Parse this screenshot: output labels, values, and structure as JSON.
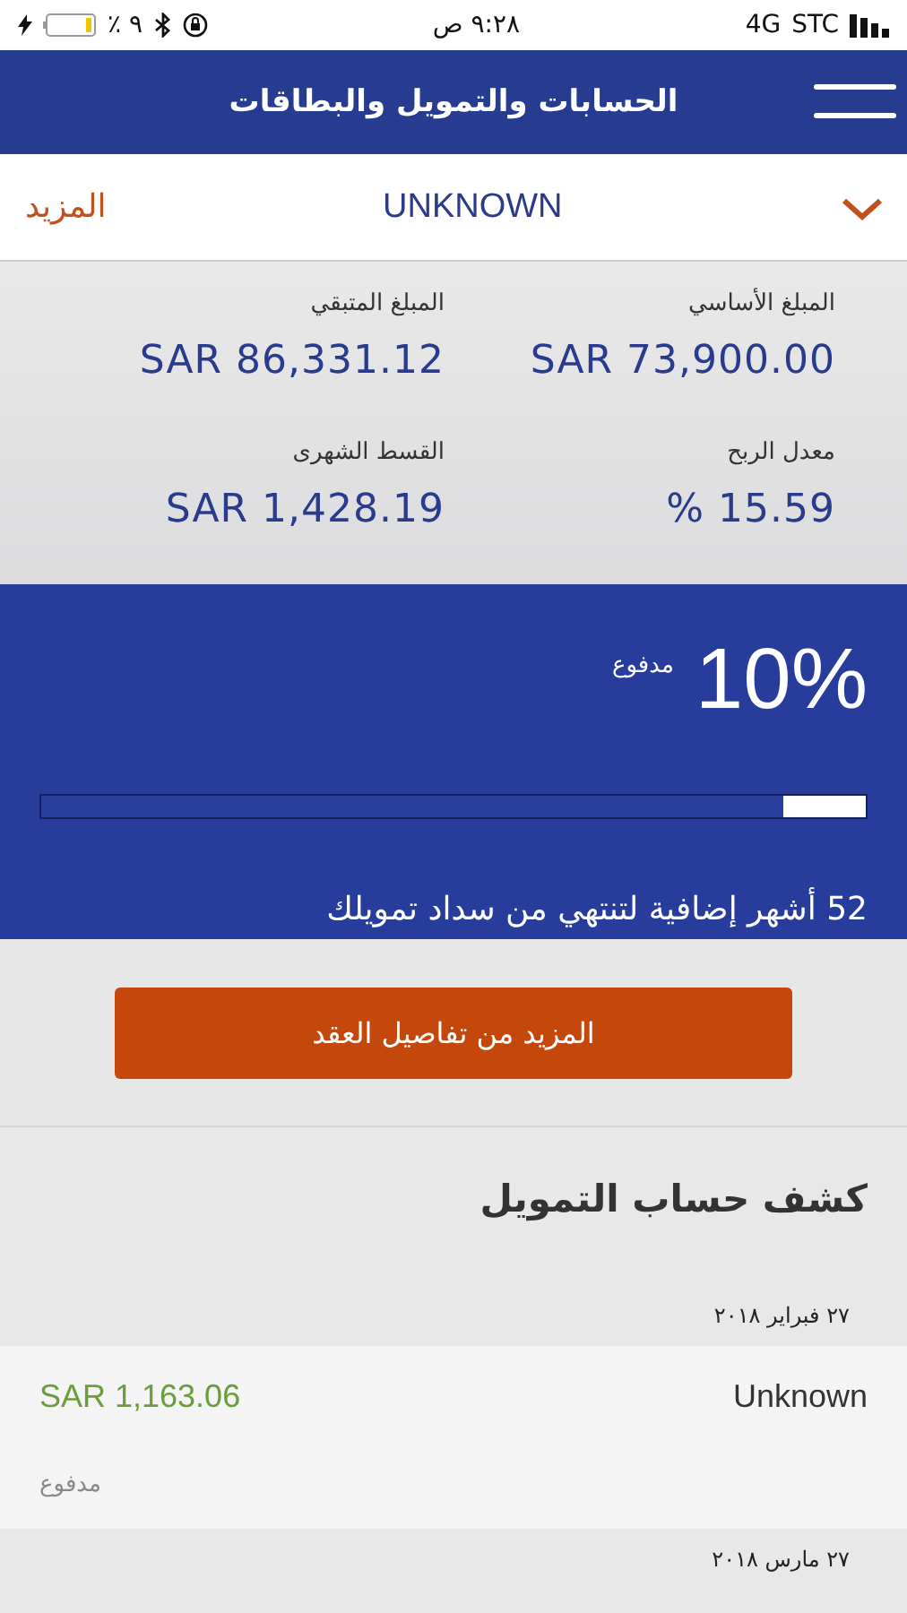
{
  "status_bar": {
    "carrier": "STC",
    "network": "4G",
    "time": "٩:٢٨ ص",
    "battery": "٪ ٩"
  },
  "header": {
    "title": "الحسابات والتمويل والبطاقات"
  },
  "account_bar": {
    "name": "UNKNOWN",
    "more": "المزيد"
  },
  "stats": [
    {
      "label": "المبلغ الأساسي",
      "value": "SAR 73,900.00"
    },
    {
      "label": "المبلغ المتبقي",
      "value": "SAR 86,331.12"
    },
    {
      "label": "معدل الربح",
      "value": "% 15.59"
    },
    {
      "label": "القسط الشهرى",
      "value": "SAR 1,428.19"
    }
  ],
  "progress": {
    "percent": "10%",
    "caption": "مدفوع",
    "level": 0.1,
    "remaining": "52 أشهر إضافية لتنتهي من سداد تمويلك"
  },
  "details_button": "المزيد من تفاصيل العقد",
  "statement": {
    "title": "كشف حساب التمويل",
    "groups": [
      {
        "date": "٢٧ فبراير ٢٠١٨",
        "entries": [
          {
            "name": "Unknown",
            "amount": "SAR 1,163.06",
            "status": "مدفوع"
          }
        ]
      },
      {
        "date": "٢٧ مارس ٢٠١٨"
      }
    ]
  }
}
